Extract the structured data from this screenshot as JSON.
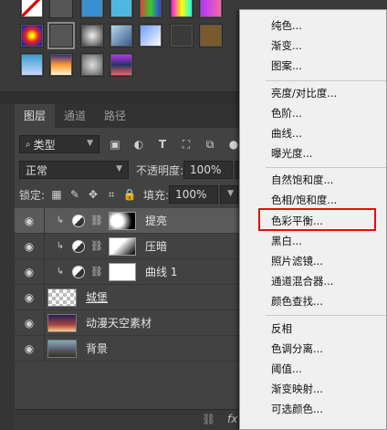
{
  "tabs": {
    "layers": "图层",
    "channels": "通道",
    "paths": "路径"
  },
  "filter": {
    "kind": "类型",
    "kind_icon": "search-icon"
  },
  "blend": {
    "mode": "正常",
    "opacity_label": "不透明度:",
    "opacity_value": "100%"
  },
  "lock": {
    "label": "锁定:",
    "fill_label": "填充:",
    "fill_value": "100%"
  },
  "layers": [
    {
      "name": "提亮",
      "type": "curves-adjustment",
      "clipped": true,
      "selected": true
    },
    {
      "name": "压暗",
      "type": "curves-adjustment",
      "clipped": true,
      "selected": false
    },
    {
      "name": "曲线 1",
      "type": "curves-adjustment",
      "clipped": true,
      "selected": false
    },
    {
      "name": "城堡",
      "type": "pixel",
      "clipped": false,
      "selected": false
    },
    {
      "name": "动漫天空素材",
      "type": "pixel",
      "clipped": false,
      "selected": false
    },
    {
      "name": "背景",
      "type": "pixel",
      "clipped": false,
      "selected": false
    }
  ],
  "footer": {
    "fx": "fx"
  },
  "menu": {
    "items": [
      "纯色...",
      "渐变...",
      "图案...",
      "亮度/对比度...",
      "色阶...",
      "曲线...",
      "曝光度...",
      "自然饱和度...",
      "色相/饱和度...",
      "色彩平衡...",
      "黑白...",
      "照片滤镜...",
      "通道混合器...",
      "颜色查找...",
      "反相",
      "色调分离...",
      "阈值...",
      "渐变映射...",
      "可选颜色..."
    ],
    "highlighted": "色彩平衡..."
  },
  "colors": {
    "highlight_box": "#e01010",
    "panel_bg": "#424242",
    "menu_bg": "#f0f0f0"
  }
}
